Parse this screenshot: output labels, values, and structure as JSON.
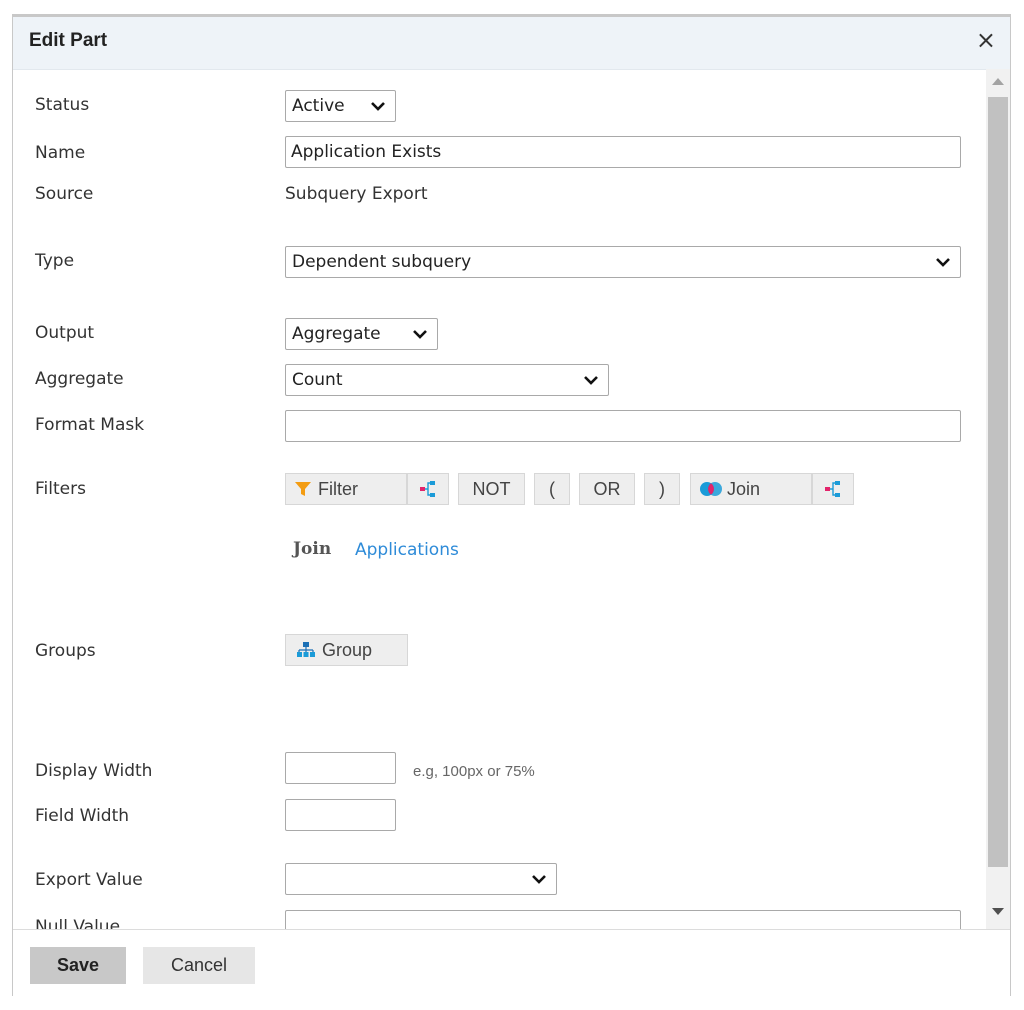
{
  "dialog": {
    "title": "Edit Part",
    "close_glyph": "×"
  },
  "form": {
    "status": {
      "label": "Status",
      "value": "Active"
    },
    "name": {
      "label": "Name",
      "value": "Application Exists"
    },
    "source": {
      "label": "Source",
      "value": "Subquery Export"
    },
    "type": {
      "label": "Type",
      "value": "Dependent subquery"
    },
    "output": {
      "label": "Output",
      "value": "Aggregate"
    },
    "aggregate": {
      "label": "Aggregate",
      "value": "Count"
    },
    "format_mask": {
      "label": "Format Mask",
      "value": ""
    },
    "filters": {
      "label": "Filters",
      "buttons": {
        "filter": "Filter",
        "not": "NOT",
        "open_paren": "(",
        "or": "OR",
        "close_paren": ")",
        "join": "Join"
      },
      "join_label": "Join",
      "join_link": "Applications"
    },
    "groups": {
      "label": "Groups",
      "button": "Group"
    },
    "display_width": {
      "label": "Display Width",
      "value": "",
      "hint": "e.g, 100px or 75%"
    },
    "field_width": {
      "label": "Field Width",
      "value": ""
    },
    "export_value": {
      "label": "Export Value",
      "value": ""
    },
    "null_value": {
      "label": "Null Value",
      "value": ""
    }
  },
  "footer": {
    "save_label": "Save",
    "cancel_label": "Cancel"
  },
  "colors": {
    "title_bar": "#eef3f8",
    "link": "#2e8bd8",
    "filter_icon": "#f39c12",
    "tree_icon": "#e3246b",
    "join_icon": "#1b9bd8"
  }
}
